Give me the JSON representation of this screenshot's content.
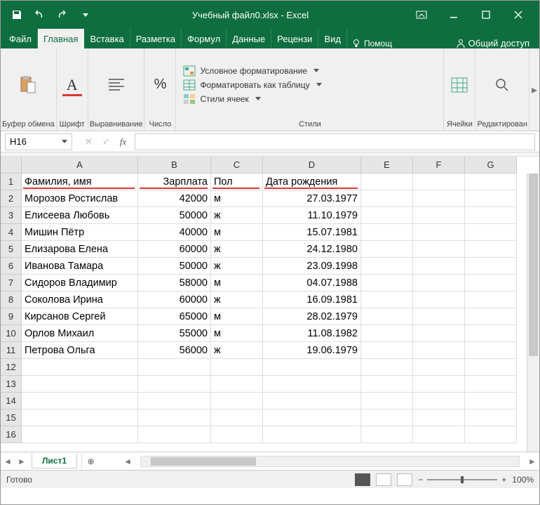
{
  "title": "Учебный файл0.xlsx - Excel",
  "tabs": {
    "file": "Файл",
    "home": "Главная",
    "insert": "Вставка",
    "layout": "Разметка",
    "formulas": "Формул",
    "data": "Данные",
    "review": "Рецензи",
    "view": "Вид",
    "help": "Помощ",
    "share": "Общий доступ"
  },
  "ribbon": {
    "clipboard": {
      "label": "Буфер обмена"
    },
    "font": {
      "label": "Шрифт"
    },
    "alignment": {
      "label": "Выравнивание"
    },
    "number": {
      "label": "Число"
    },
    "styles": {
      "label": "Стили",
      "cond_format": "Условное форматирование",
      "as_table": "Форматировать как таблицу",
      "cell_styles": "Стили ячеек"
    },
    "cells": {
      "label": "Ячейки"
    },
    "editing": {
      "label": "Редактирован"
    }
  },
  "namebox": "H16",
  "columns": [
    "A",
    "B",
    "C",
    "D",
    "E",
    "F",
    "G"
  ],
  "headers": {
    "A": "Фамилия, имя",
    "B": "Зарплата",
    "C": "Пол",
    "D": "Дата рождения"
  },
  "rows": [
    {
      "n": 1
    },
    {
      "n": 2,
      "A": "Морозов Ростислав",
      "B": "42000",
      "C": "м",
      "D": "27.03.1977"
    },
    {
      "n": 3,
      "A": "Елисеева Любовь",
      "B": "50000",
      "C": "ж",
      "D": "11.10.1979"
    },
    {
      "n": 4,
      "A": "Мишин Пётр",
      "B": "40000",
      "C": "м",
      "D": "15.07.1981"
    },
    {
      "n": 5,
      "A": "Елизарова Елена",
      "B": "60000",
      "C": "ж",
      "D": "24.12.1980"
    },
    {
      "n": 6,
      "A": "Иванова Тамара",
      "B": "50000",
      "C": "ж",
      "D": "23.09.1998"
    },
    {
      "n": 7,
      "A": "Сидоров Владимир",
      "B": "58000",
      "C": "м",
      "D": "04.07.1988"
    },
    {
      "n": 8,
      "A": "Соколова Ирина",
      "B": "60000",
      "C": "ж",
      "D": "16.09.1981"
    },
    {
      "n": 9,
      "A": "Кирсанов Сергей",
      "B": "65000",
      "C": "м",
      "D": "28.02.1979"
    },
    {
      "n": 10,
      "A": "Орлов Михаил",
      "B": "55000",
      "C": "м",
      "D": "11.08.1982"
    },
    {
      "n": 11,
      "A": "Петрова Ольга",
      "B": "56000",
      "C": "ж",
      "D": "19.06.1979"
    },
    {
      "n": 12
    },
    {
      "n": 13
    },
    {
      "n": 14
    },
    {
      "n": 15
    },
    {
      "n": 16
    }
  ],
  "sheet": "Лист1",
  "status": "Готово",
  "zoom": "100%"
}
